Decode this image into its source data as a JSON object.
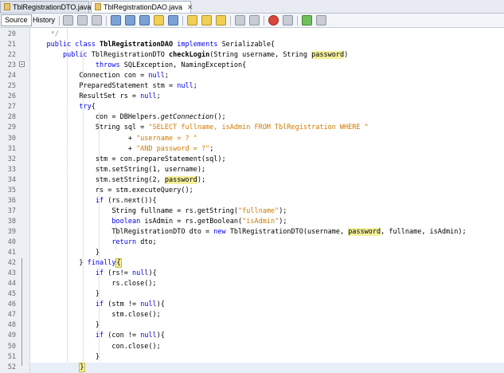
{
  "tabs": [
    {
      "label": "TblRegistrationDTO.java",
      "active": false
    },
    {
      "label": "TblRegistrationDAO.java",
      "active": true
    }
  ],
  "toolbar": {
    "source_label": "Source",
    "history_label": "History"
  },
  "editor": {
    "lines": [
      {
        "no": "20",
        "tokens": [
          [
            "cm",
            "     */"
          ]
        ]
      },
      {
        "no": "21",
        "tokens": [
          [
            "",
            "    "
          ],
          [
            "kw",
            "public class "
          ],
          [
            "b",
            "TblRegistrationDAO"
          ],
          [
            "kw",
            " implements "
          ],
          [
            "",
            "Serializable{"
          ]
        ]
      },
      {
        "no": "22",
        "tokens": [
          [
            "",
            "        "
          ],
          [
            "kw",
            "public "
          ],
          [
            "",
            "TblRegistrationDTO "
          ],
          [
            "b",
            "checkLogin"
          ],
          [
            "",
            "(String username, String "
          ],
          [
            "hl",
            "password"
          ],
          [
            "",
            ")"
          ]
        ]
      },
      {
        "no": "23",
        "tokens": [
          [
            "",
            "                "
          ],
          [
            "kw",
            "throws "
          ],
          [
            "",
            "SQLException, NamingException{"
          ]
        ]
      },
      {
        "no": "24",
        "tokens": [
          [
            "",
            "            Connection con = "
          ],
          [
            "kw",
            "null"
          ],
          [
            "",
            ";"
          ]
        ]
      },
      {
        "no": "25",
        "tokens": [
          [
            "",
            "            PreparedStatement stm = "
          ],
          [
            "kw",
            "null"
          ],
          [
            "",
            ";"
          ]
        ]
      },
      {
        "no": "26",
        "tokens": [
          [
            "",
            "            ResultSet rs = "
          ],
          [
            "kw",
            "null"
          ],
          [
            "",
            ";"
          ]
        ]
      },
      {
        "no": "27",
        "tokens": [
          [
            "",
            "            "
          ],
          [
            "kw",
            "try"
          ],
          [
            "",
            "{"
          ]
        ]
      },
      {
        "no": "28",
        "tokens": [
          [
            "",
            "                con = DBHelpers."
          ],
          [
            "it",
            "getConnection"
          ],
          [
            "",
            "();"
          ]
        ]
      },
      {
        "no": "29",
        "tokens": [
          [
            "",
            "                String sql = "
          ],
          [
            "st",
            "\"SELECT fullname, isAdmin FROM TblRegistration WHERE \""
          ]
        ]
      },
      {
        "no": "30",
        "tokens": [
          [
            "",
            "                        + "
          ],
          [
            "st",
            "\"username = ? \""
          ]
        ]
      },
      {
        "no": "31",
        "tokens": [
          [
            "",
            "                        + "
          ],
          [
            "st",
            "\"AND password = ?\""
          ],
          [
            "",
            ";"
          ]
        ]
      },
      {
        "no": "32",
        "tokens": [
          [
            "",
            "                stm = con.prepareStatement(sql);"
          ]
        ]
      },
      {
        "no": "33",
        "tokens": [
          [
            "",
            "                stm.setString(1, username);"
          ]
        ]
      },
      {
        "no": "34",
        "tokens": [
          [
            "",
            "                stm.setString(2, "
          ],
          [
            "hl",
            "password"
          ],
          [
            "",
            ");"
          ]
        ]
      },
      {
        "no": "35",
        "tokens": [
          [
            "",
            "                rs = stm.executeQuery();"
          ]
        ]
      },
      {
        "no": "36",
        "tokens": [
          [
            "",
            "                "
          ],
          [
            "kw",
            "if "
          ],
          [
            "",
            "(rs.next()){"
          ]
        ]
      },
      {
        "no": "37",
        "tokens": [
          [
            "",
            "                    String fullname = rs.getString("
          ],
          [
            "st",
            "\"fullname\""
          ],
          [
            "",
            ");"
          ]
        ]
      },
      {
        "no": "38",
        "tokens": [
          [
            "",
            "                    "
          ],
          [
            "kw",
            "boolean "
          ],
          [
            "",
            "isAdmin = rs.getBoolean("
          ],
          [
            "st",
            "\"isAdmin\""
          ],
          [
            "",
            ");"
          ]
        ]
      },
      {
        "no": "39",
        "tokens": [
          [
            "",
            "                    TblRegistrationDTO dto = "
          ],
          [
            "kw",
            "new "
          ],
          [
            "",
            "TblRegistrationDTO(username, "
          ],
          [
            "hl",
            "password"
          ],
          [
            "",
            ", fullname, isAdmin);"
          ]
        ]
      },
      {
        "no": "40",
        "tokens": [
          [
            "",
            "                    "
          ],
          [
            "kw",
            "return "
          ],
          [
            "",
            "dto;"
          ]
        ]
      },
      {
        "no": "41",
        "tokens": [
          [
            "",
            "                }"
          ]
        ]
      },
      {
        "no": "42",
        "tokens": [
          [
            "",
            "            } "
          ],
          [
            "kw",
            "finally"
          ],
          [
            "brk",
            "{"
          ]
        ]
      },
      {
        "no": "43",
        "tokens": [
          [
            "",
            "                "
          ],
          [
            "kw",
            "if "
          ],
          [
            "",
            "(rs!= "
          ],
          [
            "kw",
            "null"
          ],
          [
            "",
            "){"
          ]
        ]
      },
      {
        "no": "44",
        "tokens": [
          [
            "",
            "                    rs.close();"
          ]
        ]
      },
      {
        "no": "45",
        "tokens": [
          [
            "",
            "                }"
          ]
        ]
      },
      {
        "no": "46",
        "tokens": [
          [
            "",
            "                "
          ],
          [
            "kw",
            "if "
          ],
          [
            "",
            "(stm != "
          ],
          [
            "kw",
            "null"
          ],
          [
            "",
            "){"
          ]
        ]
      },
      {
        "no": "47",
        "tokens": [
          [
            "",
            "                    stm.close();"
          ]
        ]
      },
      {
        "no": "48",
        "tokens": [
          [
            "",
            "                }"
          ]
        ]
      },
      {
        "no": "49",
        "tokens": [
          [
            "",
            "                "
          ],
          [
            "kw",
            "if "
          ],
          [
            "",
            "(con != "
          ],
          [
            "kw",
            "null"
          ],
          [
            "",
            "){"
          ]
        ]
      },
      {
        "no": "50",
        "tokens": [
          [
            "",
            "                    con.close();"
          ]
        ]
      },
      {
        "no": "51",
        "tokens": [
          [
            "",
            "                }"
          ]
        ]
      },
      {
        "no": "52",
        "tokens": [
          [
            "",
            "            "
          ],
          [
            "brk",
            "}"
          ]
        ]
      }
    ]
  }
}
